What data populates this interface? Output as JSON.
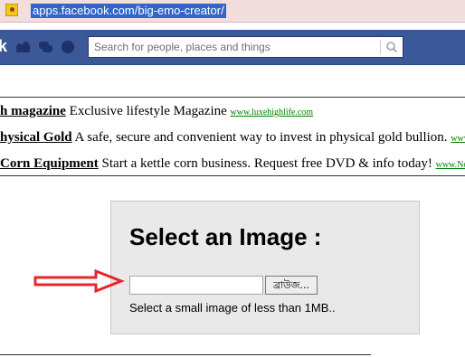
{
  "browser": {
    "url": "apps.facebook.com/big-emo-creator/"
  },
  "header": {
    "logo_fragment": "k",
    "search_placeholder": "Search for people, places and things"
  },
  "ads": [
    {
      "title": "h magazine",
      "description": "Exclusive lifestyle Magazine",
      "url": "www.luxehighlife.com"
    },
    {
      "title": "hysical Gold",
      "description": "A safe, secure and convenient way to invest in physical gold bullion.",
      "url": "www.g"
    },
    {
      "title": "Corn Equipment",
      "description": "Start a kettle corn business. Request free DVD & info today!",
      "url": "www.North"
    }
  ],
  "upload": {
    "title": "Select an Image :",
    "browse_label": "ব্রাউজ...",
    "hint": "Select a small image of less than 1MB.."
  },
  "colors": {
    "facebook_blue": "#3b5998",
    "address_bar": "#f3dede",
    "panel_bg": "#e9e9e9",
    "arrow": "#e8262b",
    "ad_url": "#008000"
  }
}
